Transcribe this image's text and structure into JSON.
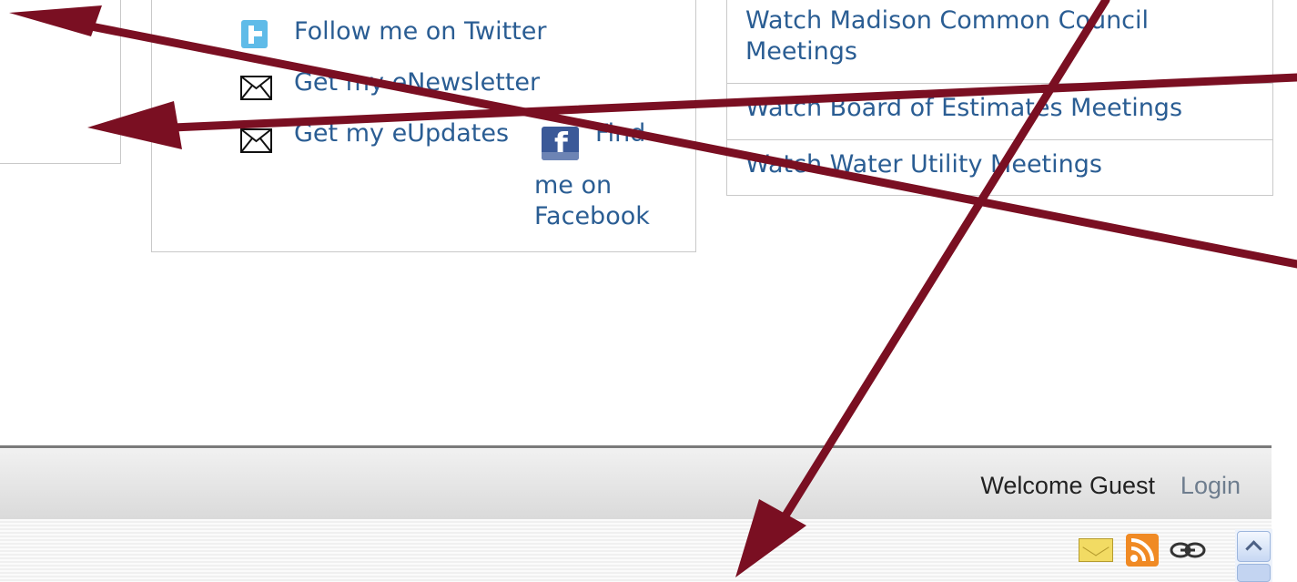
{
  "social": {
    "twitter_label": "Follow me on Twitter",
    "newsletter_label": "Get my eNewsletter",
    "eupdates_label": "Get my eUpdates",
    "facebook_label_line1": "Find",
    "facebook_label_line2": "me on",
    "facebook_label_line3": "Facebook"
  },
  "meetings": {
    "items": [
      {
        "label_line1": "Watch Madison Common Council",
        "label_line2": "Meetings"
      },
      {
        "label": "Watch Board of Estimates Meetings"
      },
      {
        "label": "Watch Water Utility Meetings"
      }
    ]
  },
  "footer": {
    "welcome": "Welcome Guest",
    "login": "Login"
  },
  "icons": {
    "twitter": "twitter-icon",
    "newsletter": "envelope-icon",
    "eupdates": "envelope-icon",
    "facebook": "facebook-icon",
    "email": "mail-icon",
    "rss": "rss-icon",
    "link": "link-icon"
  },
  "colors": {
    "link": "#2a5d93",
    "annotation_arrow": "#7a0f22",
    "rss": "#f08a24",
    "facebook": "#3b5998"
  }
}
